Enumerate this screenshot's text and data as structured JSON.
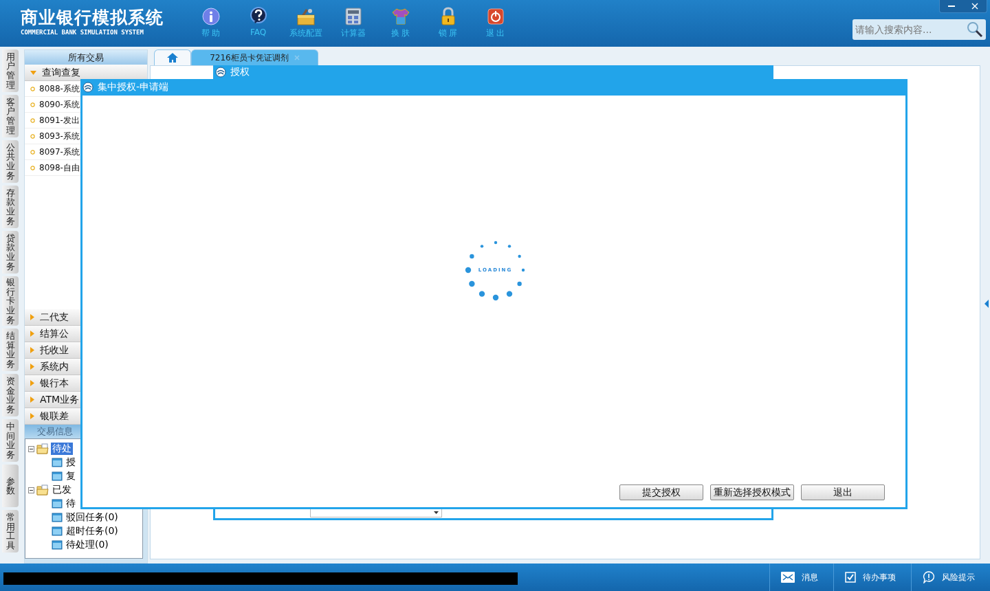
{
  "header": {
    "title": "商业银行模拟系统",
    "subtitle": "COMMERCIAL BANK SIMULATION SYSTEM",
    "tools": [
      {
        "kind": "info",
        "label": "帮 助"
      },
      {
        "kind": "help",
        "label": "FAQ"
      },
      {
        "kind": "toolbox",
        "label": "系统配置"
      },
      {
        "kind": "calculator",
        "label": "计算器"
      },
      {
        "kind": "shirt",
        "label": "换 肤"
      },
      {
        "kind": "lock",
        "label": "锁 屏"
      },
      {
        "kind": "power",
        "label": "退 出"
      }
    ],
    "search": {
      "placeholder": "请输入搜索内容..."
    }
  },
  "side_tabs": [
    "用户管理",
    "客户管理",
    "公共业务",
    "存款业务",
    "贷款业务",
    "银行卡业务",
    "结算业务",
    "资金业务",
    "中间业务",
    "参数",
    "常用工具"
  ],
  "sidebar": {
    "title": "所有交易",
    "groups": [
      {
        "label": "查询查复",
        "expanded": true,
        "items": [
          "8088-系统",
          "8090-系统",
          "8091-发出",
          "8093-系统",
          "8097-系统",
          "8098-自由"
        ]
      },
      {
        "label": "二代支",
        "expanded": false
      },
      {
        "label": "结算公",
        "expanded": false
      },
      {
        "label": "托收业",
        "expanded": false
      },
      {
        "label": "系统内",
        "expanded": false
      },
      {
        "label": "银行本",
        "expanded": false
      },
      {
        "label": "ATM业务",
        "expanded": false
      },
      {
        "label": "银联差",
        "expanded": false
      }
    ]
  },
  "info_panel": {
    "title": "交易信息",
    "tree": [
      {
        "label": "待处",
        "selected": true,
        "expanded": true,
        "children": [
          {
            "label": "授",
            "selected": false
          },
          {
            "label": "复",
            "selected": false
          }
        ]
      },
      {
        "label": "已发",
        "selected": false,
        "expanded": true,
        "children": [
          {
            "label": "待",
            "selected": false
          },
          {
            "label": "驳回任务(0)",
            "selected": false
          },
          {
            "label": "超时任务(0)",
            "selected": false
          },
          {
            "label": "待处理(0)",
            "selected": false
          }
        ]
      }
    ]
  },
  "tabs": [
    {
      "kind": "home",
      "selected": false
    },
    {
      "kind": "text",
      "label": "7216柜员卡凭证调剂",
      "selected": true
    }
  ],
  "auth_dialog": {
    "title": "授权"
  },
  "dialog": {
    "title": "集中授权-申请端",
    "loading_text": "LOADING",
    "buttons": [
      "提交授权",
      "重新选择授权模式",
      "退出"
    ]
  },
  "status_bar": {
    "items": [
      {
        "kind": "mail",
        "label": "消息"
      },
      {
        "kind": "check",
        "label": "待办事项"
      },
      {
        "kind": "alert",
        "label": "风险提示"
      }
    ]
  }
}
